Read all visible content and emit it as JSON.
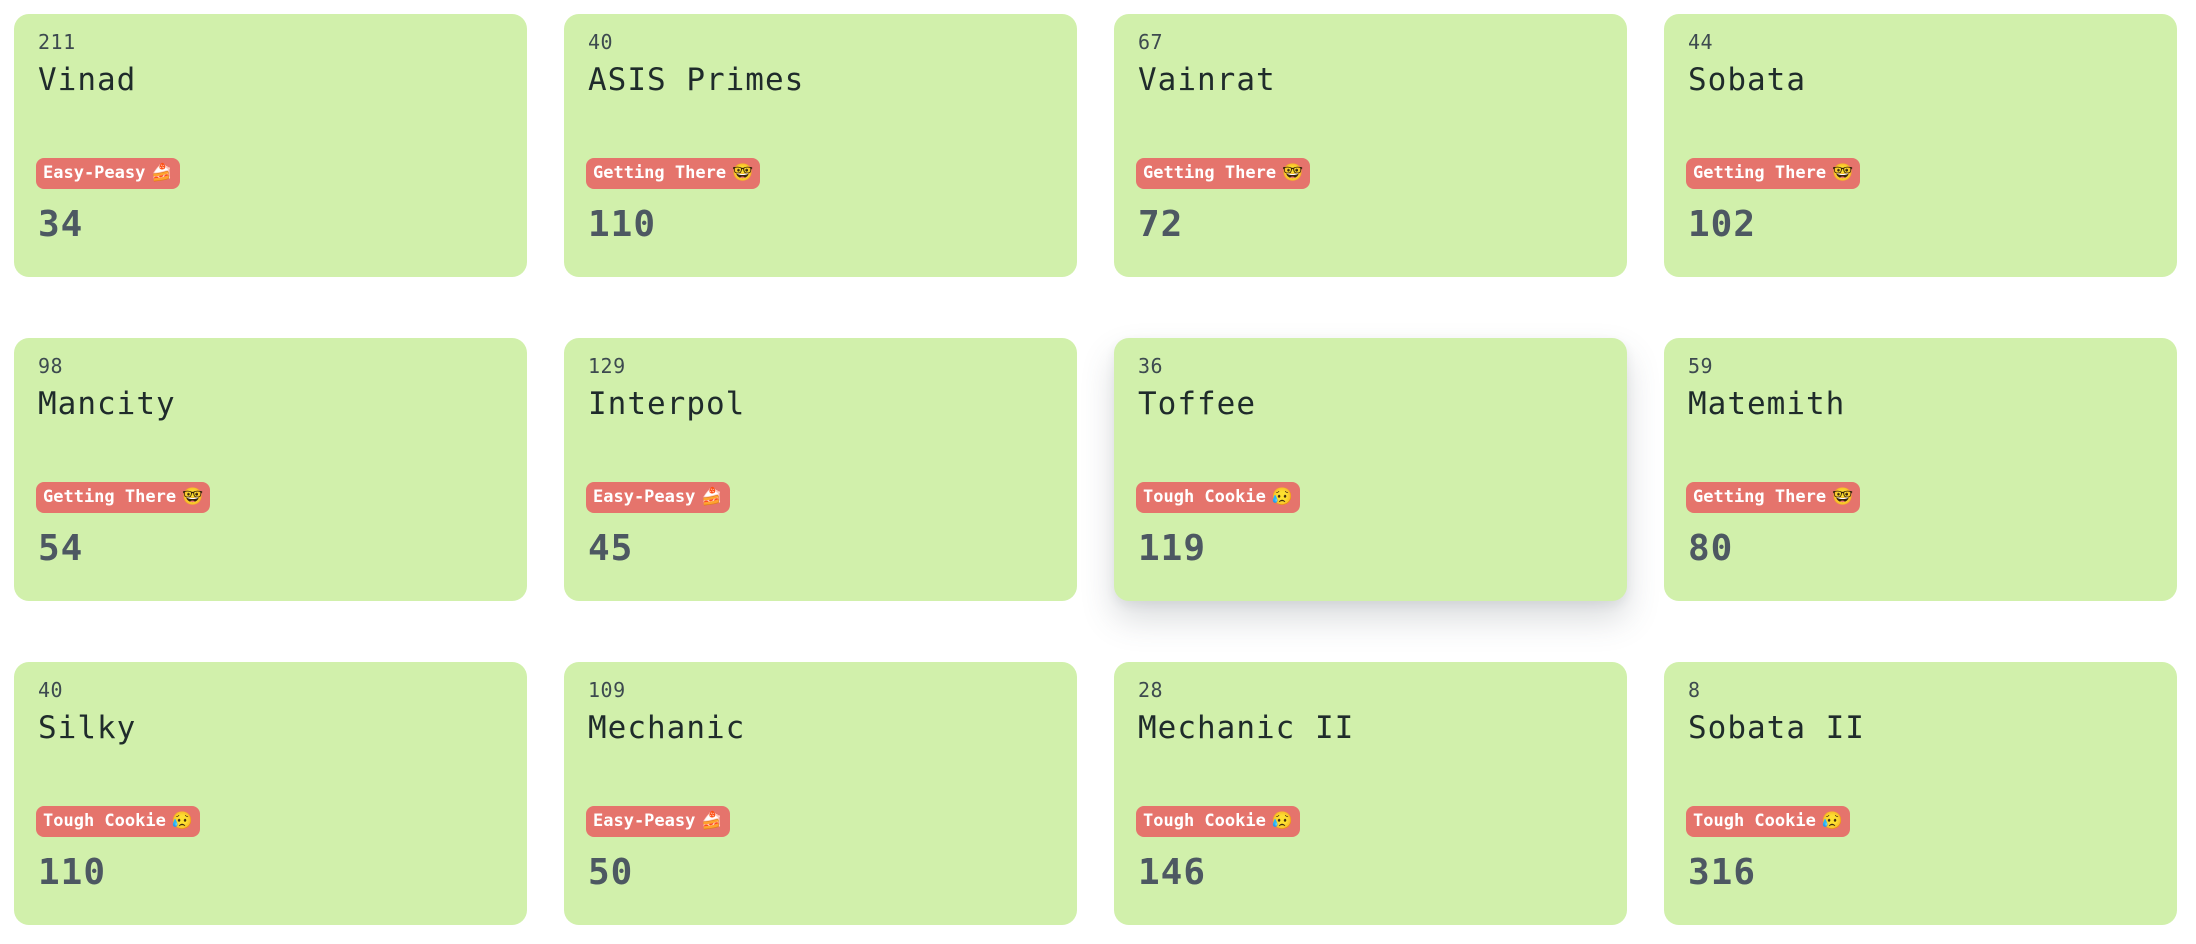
{
  "cards": [
    {
      "id": "211",
      "name": "Vinad",
      "difficulty": "Easy-Peasy",
      "emoji": "🍰",
      "emoji_name": "cake-icon",
      "score": "34"
    },
    {
      "id": "40",
      "name": "ASIS Primes",
      "difficulty": "Getting There",
      "emoji": "🤓",
      "emoji_name": "nerd-face-icon",
      "score": "110"
    },
    {
      "id": "67",
      "name": "Vainrat",
      "difficulty": "Getting There",
      "emoji": "🤓",
      "emoji_name": "nerd-face-icon",
      "score": "72"
    },
    {
      "id": "44",
      "name": "Sobata",
      "difficulty": "Getting There",
      "emoji": "🤓",
      "emoji_name": "nerd-face-icon",
      "score": "102"
    },
    {
      "id": "98",
      "name": "Mancity",
      "difficulty": "Getting There",
      "emoji": "🤓",
      "emoji_name": "nerd-face-icon",
      "score": "54"
    },
    {
      "id": "129",
      "name": "Interpol",
      "difficulty": "Easy-Peasy",
      "emoji": "🍰",
      "emoji_name": "cake-icon",
      "score": "45"
    },
    {
      "id": "36",
      "name": "Toffee",
      "difficulty": "Tough Cookie",
      "emoji": "😥",
      "emoji_name": "sweat-face-icon",
      "score": "119"
    },
    {
      "id": "59",
      "name": "Matemith",
      "difficulty": "Getting There",
      "emoji": "🤓",
      "emoji_name": "nerd-face-icon",
      "score": "80"
    },
    {
      "id": "40",
      "name": "Silky",
      "difficulty": "Tough Cookie",
      "emoji": "😥",
      "emoji_name": "sweat-face-icon",
      "score": "110"
    },
    {
      "id": "109",
      "name": "Mechanic",
      "difficulty": "Easy-Peasy",
      "emoji": "🍰",
      "emoji_name": "cake-icon",
      "score": "50"
    },
    {
      "id": "28",
      "name": "Mechanic II",
      "difficulty": "Tough Cookie",
      "emoji": "😥",
      "emoji_name": "sweat-face-icon",
      "score": "146"
    },
    {
      "id": "8",
      "name": "Sobata II",
      "difficulty": "Tough Cookie",
      "emoji": "😥",
      "emoji_name": "sweat-face-icon",
      "score": "316"
    }
  ],
  "colors": {
    "card_background": "#d1f0ab",
    "badge_background": "#e5746c",
    "badge_text": "#ffffff",
    "score_text": "#4d5862",
    "name_text": "#1f2b2b"
  },
  "hovered_card_index": 6
}
